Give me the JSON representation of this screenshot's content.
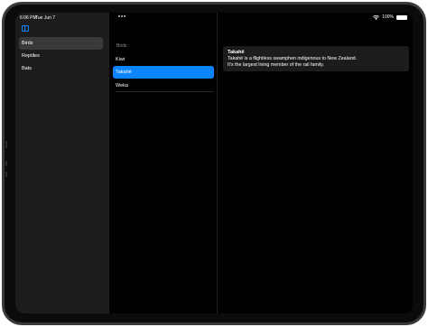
{
  "status_bar": {
    "time": "6:06 PM",
    "date": "Tue Jun 7",
    "battery": "100%",
    "battery_level": 1.0,
    "wifi_icon": "wifi-icon",
    "battery_icon": "battery-icon"
  },
  "sidebar": {
    "toggle_icon": "sidebar-icon",
    "items": [
      {
        "label": "Birds",
        "selected": true
      },
      {
        "label": "Reptiles",
        "selected": false
      },
      {
        "label": "Bats",
        "selected": false
      }
    ]
  },
  "content": {
    "multitask_icon": "more-icon",
    "section_header": "Birds",
    "rows": [
      {
        "label": "Kiwi",
        "selected": false
      },
      {
        "label": "Takahē",
        "selected": true
      },
      {
        "label": "Weka",
        "selected": false
      }
    ]
  },
  "detail": {
    "title": "Takahē",
    "line1": "Takahē is a flightless swamphen indigenous to New Zealand.",
    "line2": "It's the largest living member of the rail family."
  },
  "colors": {
    "accent": "#0a84ff",
    "background": "#000000",
    "sidebar": "#1c1c1e"
  }
}
